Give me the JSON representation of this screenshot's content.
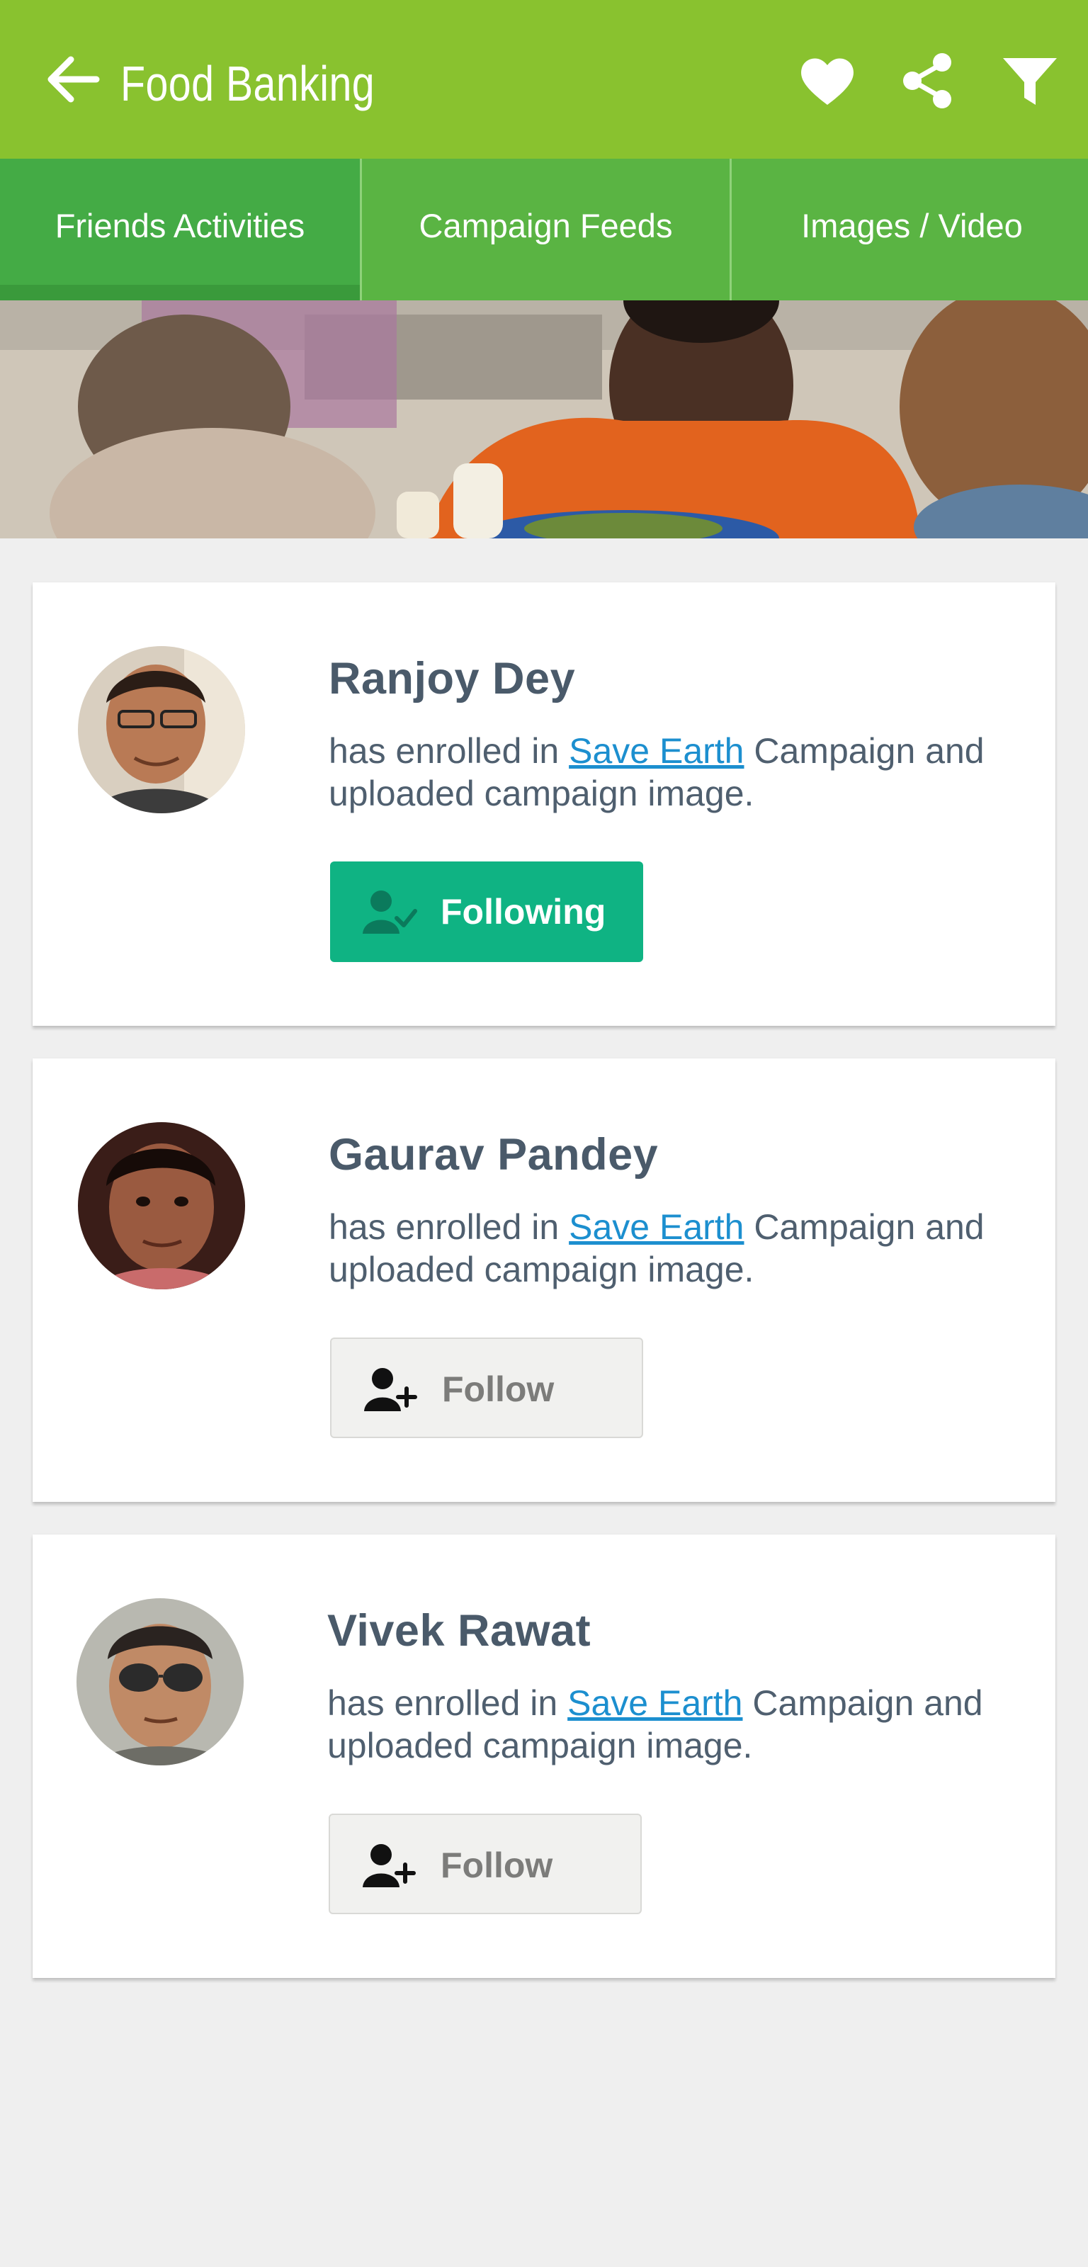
{
  "app": {
    "title": "Food Banking",
    "colors": {
      "appbar": "#89c22f",
      "tabs": "#5ab443",
      "active_tab": "#44ab45",
      "following": "#0fb383",
      "link": "#1c8fcf"
    },
    "icons": [
      "back-arrow-icon",
      "heart-icon",
      "share-icon",
      "filter-icon"
    ]
  },
  "tabs": [
    {
      "label": "Friends Activities",
      "active": true
    },
    {
      "label": "Campaign Feeds",
      "active": false
    },
    {
      "label": "Images / Video",
      "active": false
    }
  ],
  "feed": [
    {
      "name": "Ranjoy Dey",
      "text_before": "has enrolled in ",
      "link": "Save Earth",
      "text_after": " Campaign and uploaded campaign image.",
      "button": "Following",
      "state": "following"
    },
    {
      "name": "Gaurav Pandey",
      "text_before": "has enrolled in ",
      "link": "Save Earth",
      "text_after": " Campaign and uploaded campaign image.",
      "button": "Follow",
      "state": "follow"
    },
    {
      "name": "Vivek Rawat",
      "text_before": "has enrolled in ",
      "link": "Save Earth",
      "text_after": " Campaign and uploaded campaign image.",
      "button": "Follow",
      "state": "follow"
    }
  ]
}
